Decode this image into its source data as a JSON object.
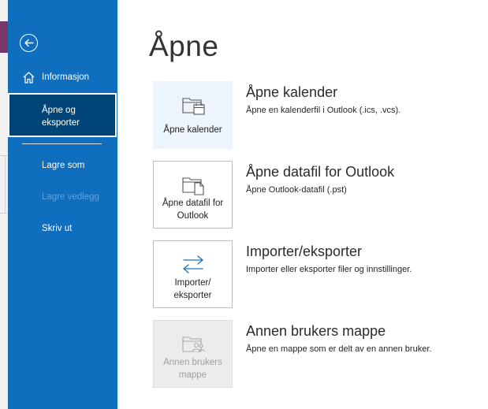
{
  "backstage": {
    "back_icon": "back-arrow-icon",
    "nav_items": [
      {
        "label": "Informasjon",
        "icon": "house-icon",
        "state": "normal"
      },
      {
        "label": "Åpne og eksporter",
        "state": "selected"
      },
      {
        "label": "Lagre som",
        "state": "normal"
      },
      {
        "label": "Lagre vedlegg",
        "state": "disabled"
      },
      {
        "label": "Skriv ut",
        "state": "normal"
      }
    ]
  },
  "main": {
    "title": "Åpne",
    "options": [
      {
        "tile_label": "Åpne kalender",
        "icon": "open-calendar-icon",
        "title": "Åpne kalender",
        "description": "Åpne en kalenderfil i Outlook (.ics, .vcs)."
      },
      {
        "tile_label": "Åpne datafil for Outlook",
        "icon": "open-datafile-icon",
        "title": "Åpne datafil for Outlook",
        "description": "Åpne Outlook-datafil (.pst)"
      },
      {
        "tile_label": "Importer/ eksporter",
        "icon": "import-export-arrows-icon",
        "title": "Importer/eksporter",
        "description": "Importer eller eksporter filer og innstillinger."
      },
      {
        "tile_label": "Annen brukers mappe",
        "icon": "shared-folder-icon",
        "title": "Annen brukers mappe",
        "description": "Åpne en mappe som er delt av en annen bruker."
      }
    ]
  },
  "colors": {
    "nav_bg": "#106ebe",
    "nav_selected": "#004578",
    "accent_purple": "#7a3569"
  }
}
